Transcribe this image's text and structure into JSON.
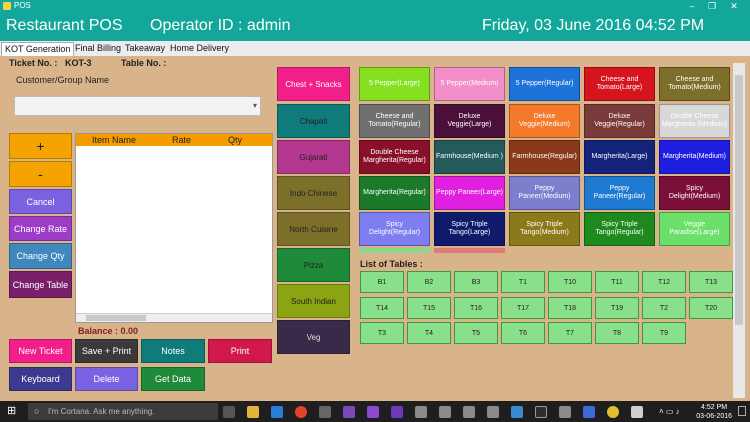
{
  "window": {
    "title": "POS"
  },
  "header": {
    "app": "Restaurant POS",
    "operator": "Operator ID :  admin",
    "datetime": "Friday, 03 June 2016 04:52 PM"
  },
  "tabs": [
    "KOT Generation",
    "Final Billing",
    "Takeaway",
    "Home Delivery"
  ],
  "ticket": {
    "label": "Ticket No. :",
    "value": "KOT-3",
    "table_label": "Table No. :"
  },
  "group": {
    "label": "Customer/Group Name",
    "value": ""
  },
  "side_buttons": [
    "+",
    "-",
    "Cancel",
    "Change Rate",
    "Change Qty",
    "Change Table"
  ],
  "grid_headers": [
    "Item Name",
    "Rate",
    "Qty"
  ],
  "balance": "Balance :  0.00",
  "bottom_buttons": [
    "New Ticket",
    "Save + Print",
    "Notes",
    "Print",
    "Keyboard",
    "Delete",
    "Get Data"
  ],
  "categories": [
    "Chest + Snacks",
    "Chapati",
    "Gujarati",
    "Indo Chinese",
    "North Cuisine",
    "Pizza",
    "South Indian",
    "Veg"
  ],
  "items": [
    "5 Pepper(Large)",
    "5 Pepper(Medium)",
    "5 Pepper(Regular)",
    "Cheese and Tomato(Large)",
    "Cheese and Tomato(Medium)",
    "Cheese and Tomato(Regular)",
    "Deluxe Veggie(Large)",
    "Deluxe Veggie(Medium)",
    "Deluxe Veggie(Regular)",
    "Double Cheese Margherita (Medium)",
    "Double Cheese Margherita(Regular)",
    "Farmhouse(Medium )",
    "Farmhouse(Regular)",
    "Margherita(Large)",
    "Margherita(Medium)",
    "Margherita(Regular)",
    "Peppy Paneer(Large)",
    "Peppy Paneer(Medium)",
    "Peppy Paneer(Regular)",
    "Spicy Delight(Medium)",
    "Spicy Delight(Regular)",
    "Spicy Triple Tango(Large)",
    "Spicy Triple Tango(Medium)",
    "Spicy Triple Tango(Regular)",
    "Veggie Paradise(Large)"
  ],
  "tables_label": "List of Tables :",
  "tables": [
    "B1",
    "B2",
    "B3",
    "T1",
    "T10",
    "T11",
    "T12",
    "T13",
    "T14",
    "T15",
    "T16",
    "T17",
    "T18",
    "T19",
    "T2",
    "T20",
    "T3",
    "T4",
    "T5",
    "T6",
    "T7",
    "T8",
    "T9"
  ],
  "taskbar": {
    "search_placeholder": "I'm Cortana. Ask me anything.",
    "time": "4:52 PM",
    "date": "03-06-2016"
  },
  "colors": {
    "titlebar": "#12a79a",
    "background": "#d9b48a",
    "grid_header": "#f59c00",
    "table_tile": "#88e08a"
  }
}
